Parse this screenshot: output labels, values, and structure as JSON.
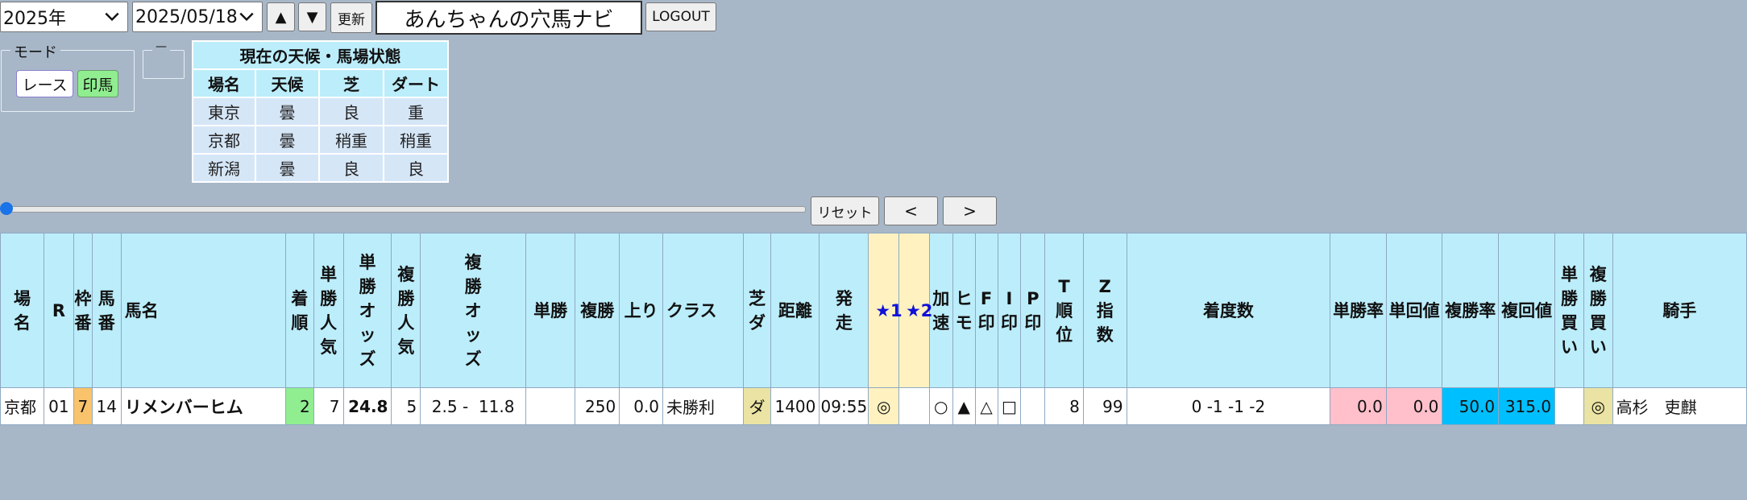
{
  "toolbar": {
    "year": "2025年",
    "date": "2025/05/18",
    "up_label": "▲",
    "down_label": "▼",
    "refresh_label": "更新",
    "title": "あんちゃんの穴馬ナビ",
    "logout_label": "LOGOUT"
  },
  "mode": {
    "legend": "モード",
    "race_label": "レース",
    "mark_label": "印馬",
    "second_legend": "—"
  },
  "weather": {
    "title": "現在の天候・馬場状態",
    "headers": [
      "場名",
      "天候",
      "芝",
      "ダート"
    ],
    "rows": [
      [
        "東京",
        "曇",
        "良",
        "重"
      ],
      [
        "京都",
        "曇",
        "稍重",
        "稍重"
      ],
      [
        "新潟",
        "曇",
        "良",
        "良"
      ]
    ]
  },
  "slider_controls": {
    "reset_label": "リセット",
    "prev_label": "<",
    "next_label": ">"
  },
  "table": {
    "headers": [
      "場名",
      "R",
      "枠番",
      "馬番",
      "馬名",
      "着順",
      "単勝人気",
      "単勝オッズ",
      "複勝人気",
      "複勝オッズ",
      "単勝",
      "複勝",
      "上り",
      "クラス",
      "芝ダ",
      "距離",
      "発走",
      "★1",
      "★2",
      "加速",
      "ヒモ",
      "F印",
      "I印",
      "P印",
      "T順位",
      "Z指数",
      "着度数",
      "単勝率",
      "単回値",
      "複勝率",
      "複回値",
      "単勝買い",
      "複勝買い",
      "騎手"
    ],
    "row": {
      "venue": "京都",
      "race": "01",
      "waku": "7",
      "umaban": "14",
      "horse": "リメンバーヒム",
      "finish": "2",
      "win_pop": "7",
      "win_odds": "24.8",
      "place_pop": "5",
      "place_odds": "2.5 -  11.8",
      "win_pay": "",
      "place_pay": "250",
      "last3f": "0.0",
      "class": "未勝利",
      "surface": "ダ",
      "distance": "1400",
      "start": "09:55",
      "star1": "◎",
      "star2": "",
      "accel": "○",
      "himo": "▲",
      "f_mark": "△",
      "i_mark": "□",
      "p_mark": "",
      "t_rank": "8",
      "z_index": "99",
      "record": "0 -1 -1 -2",
      "win_rate": "0.0",
      "win_return": "0.0",
      "place_rate": "50.0",
      "place_return": "315.0",
      "win_buy": "",
      "place_buy": "◎",
      "jockey": "高杉　吏麒"
    }
  },
  "colors": {
    "background": "#a7b7c8",
    "header": "#bcedfb",
    "mark_button": "#90ee90",
    "waku_7": "#f9c36b",
    "finish_2": "#90ee90",
    "star_col": "#fff2c0",
    "surface_dirt": "#eae3a3",
    "pink": "#ffc0cb",
    "blue": "#00bfff"
  }
}
